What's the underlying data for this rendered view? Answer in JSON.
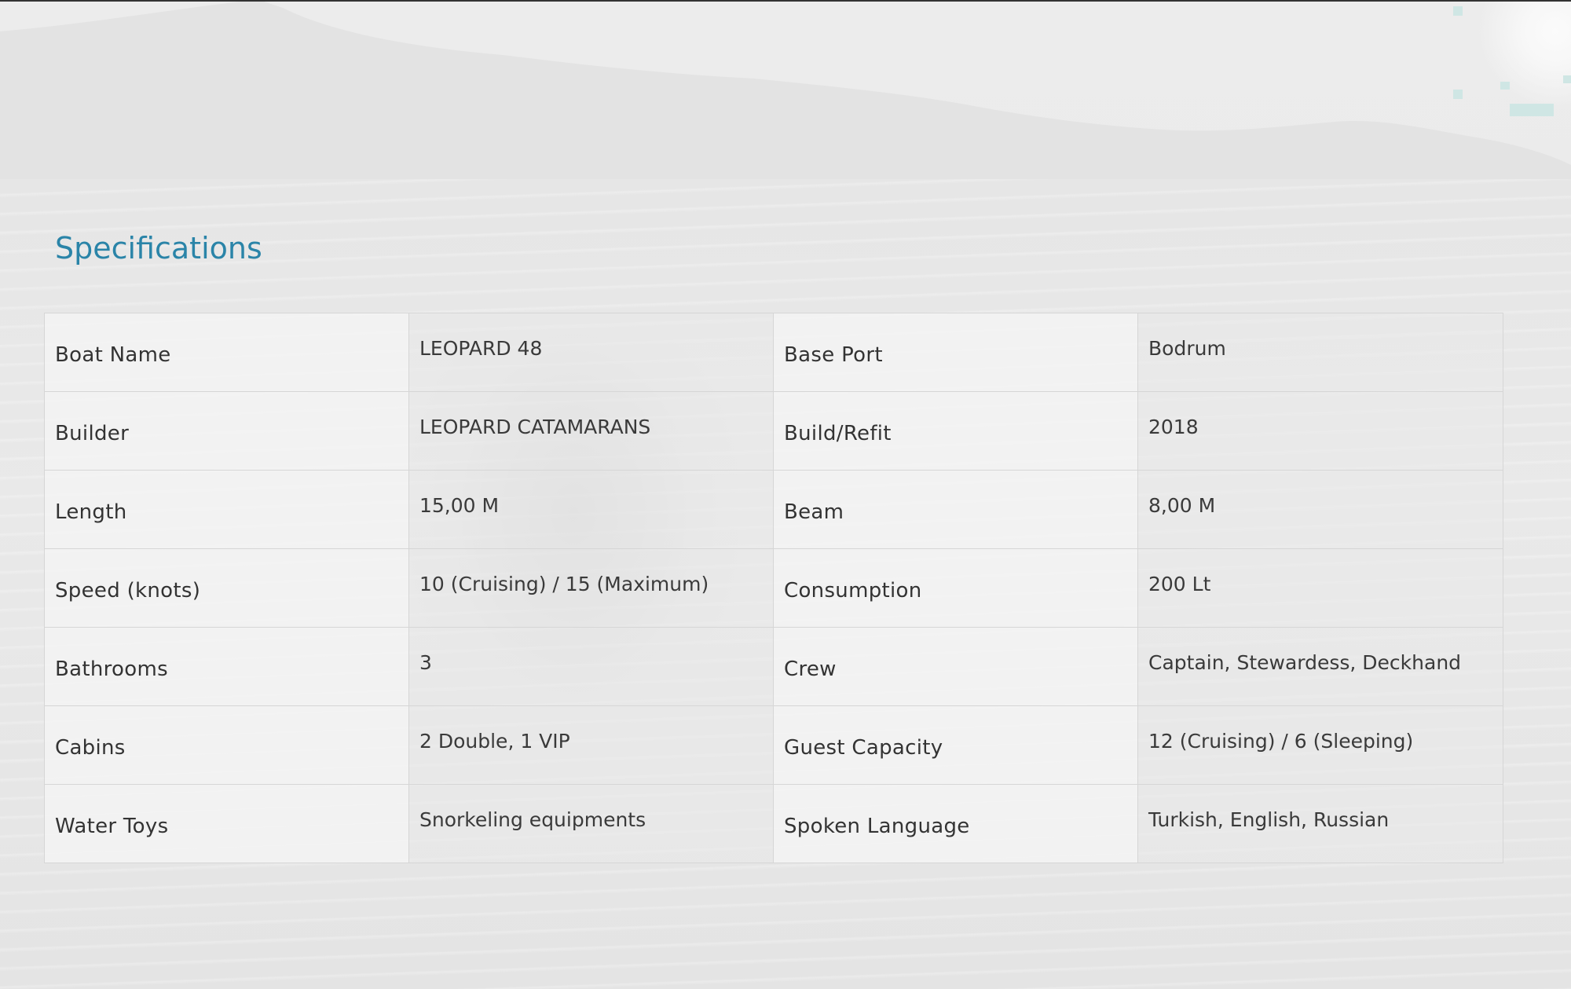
{
  "section": {
    "title": "Specifications"
  },
  "specs": [
    {
      "label1": "Boat Name",
      "value1": "LEOPARD 48",
      "label2": "Base Port",
      "value2": "Bodrum"
    },
    {
      "label1": "Builder",
      "value1": "LEOPARD CATAMARANS",
      "label2": "Build/Refit",
      "value2": "2018"
    },
    {
      "label1": "Length",
      "value1": "15,00 M",
      "label2": "Beam",
      "value2": "8,00 M"
    },
    {
      "label1": "Speed (knots)",
      "value1": "10 (Cruising) / 15 (Maximum)",
      "label2": "Consumption",
      "value2": "200 Lt"
    },
    {
      "label1": "Bathrooms",
      "value1": "3",
      "label2": "Crew",
      "value2": "Captain, Stewardess, Deckhand"
    },
    {
      "label1": "Cabins",
      "value1": "2 Double, 1 VIP",
      "label2": "Guest Capacity",
      "value2": "12 (Cruising) / 6 (Sleeping)"
    },
    {
      "label1": "Water Toys",
      "value1": "Snorkeling equipments",
      "label2": "Spoken Language",
      "value2": "Turkish, English, Russian"
    }
  ],
  "colors": {
    "title": "#2a84a8",
    "text": "#333333",
    "border": "#d6d6d6"
  }
}
